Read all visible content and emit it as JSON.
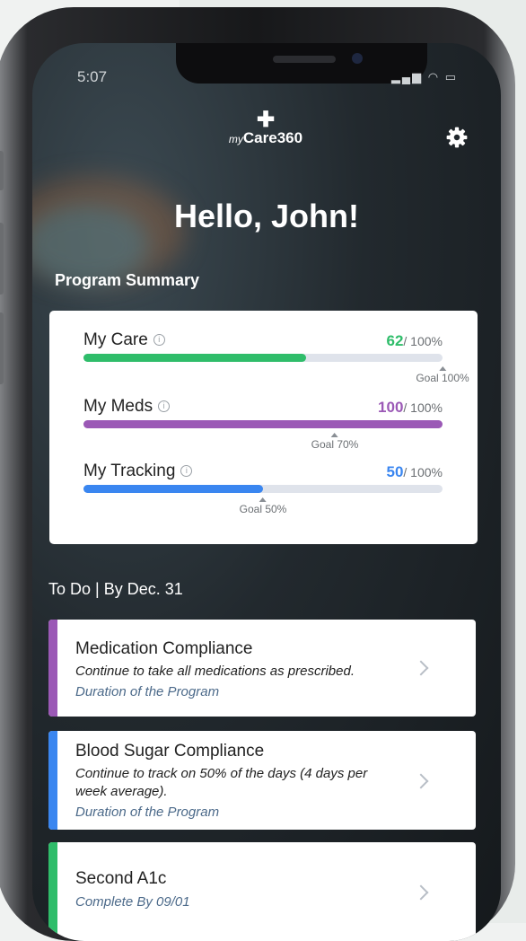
{
  "status_bar": {
    "time": "5:07",
    "icons": "▂▄▆ ◠ ▭"
  },
  "header": {
    "logo_prefix": "my",
    "logo_name": "Care360",
    "logo_cross": "✚"
  },
  "greeting": "Hello, John!",
  "summary": {
    "title": "Program Summary",
    "items": [
      {
        "label": "My Care",
        "value": "62",
        "suffix": "/ 100%",
        "goal": "Goal 100%",
        "progress": 62,
        "goal_pct": 100,
        "color": "#2fbd6a"
      },
      {
        "label": "My Meds",
        "value": "100",
        "suffix": "/ 100%",
        "goal": "Goal 70%",
        "progress": 100,
        "goal_pct": 70,
        "color": "#9b59b6"
      },
      {
        "label": "My Tracking",
        "value": "50",
        "suffix": "/ 100%",
        "goal": "Goal 50%",
        "progress": 50,
        "goal_pct": 50,
        "color": "#3a86f0"
      }
    ]
  },
  "todo": {
    "title": "To Do | By Dec. 31",
    "items": [
      {
        "title": "Medication Compliance",
        "desc": "Continue to take all medications as prescribed.",
        "sub": "Duration of the Program",
        "color": "#9b59b6"
      },
      {
        "title": "Blood Sugar Compliance",
        "desc": "Continue to track on 50% of the days (4 days per week average).",
        "sub": "Duration of the Program",
        "color": "#3a86f0"
      },
      {
        "title": "Second A1c",
        "desc": "",
        "sub": "Complete By 09/01",
        "color": "#2fbd6a"
      }
    ]
  }
}
